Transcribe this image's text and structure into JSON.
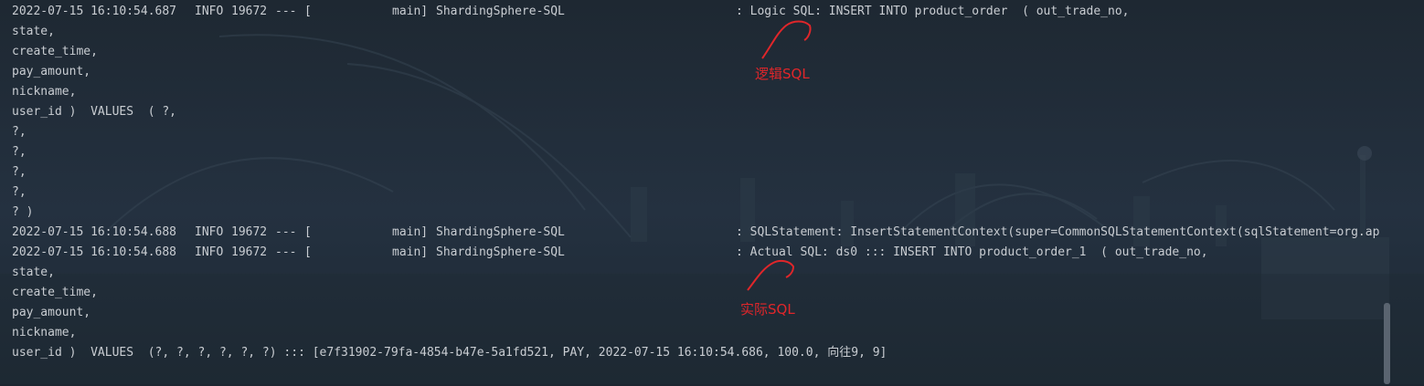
{
  "console": {
    "lines": [
      {
        "kind": "log",
        "timestamp": "2022-07-15 16:10:54.687",
        "level": "INFO",
        "pid": "19672",
        "dashes": "---",
        "bracket": "[",
        "thread": "main]",
        "logger": "ShardingSphere-SQL",
        "message": ": Logic SQL: INSERT INTO product_order  ( out_trade_no,"
      },
      {
        "kind": "cont",
        "text": "state,"
      },
      {
        "kind": "cont",
        "text": "create_time,"
      },
      {
        "kind": "cont",
        "text": "pay_amount,"
      },
      {
        "kind": "cont",
        "text": "nickname,"
      },
      {
        "kind": "cont",
        "text": "user_id )  VALUES  ( ?,"
      },
      {
        "kind": "cont",
        "text": "?,"
      },
      {
        "kind": "cont",
        "text": "?,"
      },
      {
        "kind": "cont",
        "text": "?,"
      },
      {
        "kind": "cont",
        "text": "?,"
      },
      {
        "kind": "cont",
        "text": "? )"
      },
      {
        "kind": "log",
        "timestamp": "2022-07-15 16:10:54.688",
        "level": "INFO",
        "pid": "19672",
        "dashes": "---",
        "bracket": "[",
        "thread": "main]",
        "logger": "ShardingSphere-SQL",
        "message": ": SQLStatement: InsertStatementContext(super=CommonSQLStatementContext(sqlStatement=org.ap"
      },
      {
        "kind": "log",
        "timestamp": "2022-07-15 16:10:54.688",
        "level": "INFO",
        "pid": "19672",
        "dashes": "---",
        "bracket": "[",
        "thread": "main]",
        "logger": "ShardingSphere-SQL",
        "message": ": Actual SQL: ds0 ::: INSERT INTO product_order_1  ( out_trade_no,"
      },
      {
        "kind": "cont",
        "text": "state,"
      },
      {
        "kind": "cont",
        "text": "create_time,"
      },
      {
        "kind": "cont",
        "text": "pay_amount,"
      },
      {
        "kind": "cont",
        "text": "nickname,"
      },
      {
        "kind": "cont",
        "text": "user_id )  VALUES  (?, ?, ?, ?, ?, ?) ::: [e7f31902-79fa-4854-b47e-5a1fd521, PAY, 2022-07-15 16:10:54.686, 100.0, 向往9, 9]"
      }
    ]
  },
  "annotations": {
    "logic": {
      "label": "逻辑SQL"
    },
    "actual": {
      "label": "实际SQL"
    },
    "color": "#e0262a"
  },
  "colors": {
    "console_text": "#c9cdd2",
    "background": "#1c2530"
  }
}
